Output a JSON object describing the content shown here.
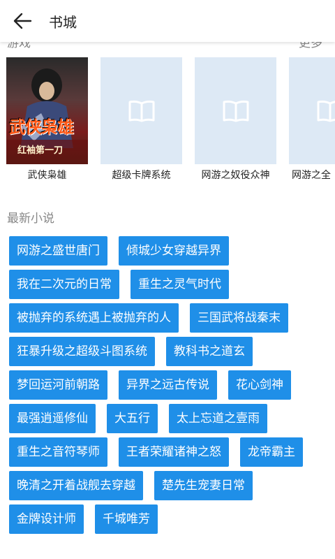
{
  "header": {
    "title": "书城",
    "back_icon": "arrow-left-icon"
  },
  "section_game": {
    "label": "游戏",
    "more": "更多"
  },
  "books": [
    {
      "title": "武侠枭雄",
      "cover_text_main": "武侠枭雄",
      "cover_text_sub": "红袖第一刀"
    },
    {
      "title": "超级卡牌系统",
      "cover_icon": "book-icon"
    },
    {
      "title": "网游之奴役众神",
      "cover_icon": "book-icon"
    },
    {
      "title": "网游之全",
      "cover_icon": "book-icon"
    }
  ],
  "latest": {
    "label": "最新小说",
    "tags": [
      "网游之盛世唐门",
      "倾城少女穿越异界",
      "我在二次元的日常",
      "重生之灵气时代",
      "被抛弃的系统遇上被抛弃的人",
      "三国武将战秦末",
      "狂暴升级之超级斗图系统",
      "教科书之道玄",
      "梦回运河前朝路",
      "异界之远古传说",
      "花心剑神",
      "最强逍遥修仙",
      "大五行",
      "太上忘道之壹雨",
      "重生之音符琴师",
      "王者荣耀诸神之怒",
      "龙帝霸主",
      "晚清之开着战舰去穿越",
      "楚先生宠妻日常",
      "金牌设计师",
      "千城唯芳"
    ]
  },
  "colors": {
    "tag_bg": "#1f8fe8",
    "placeholder_bg": "#dde9f5",
    "label_gray": "#888888"
  }
}
